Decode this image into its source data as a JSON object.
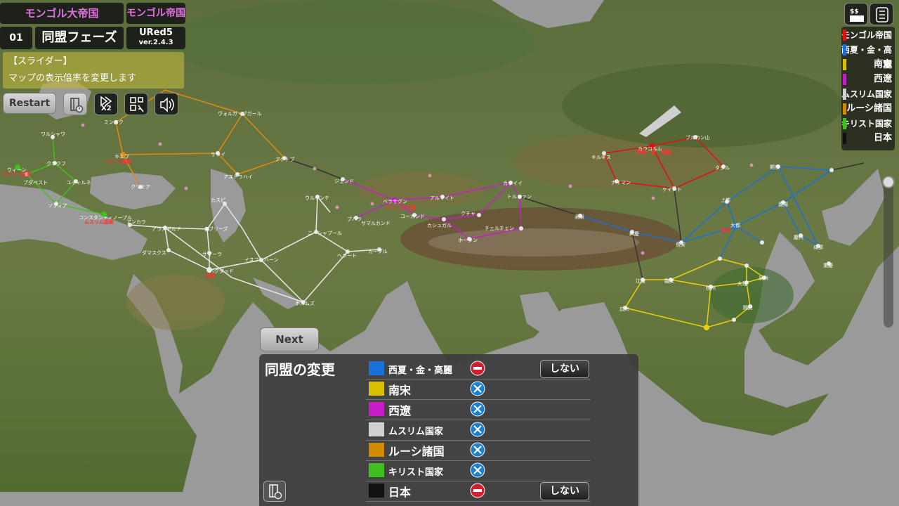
{
  "header": {
    "faction": "モンゴル大帝国",
    "player": "モンゴル帝国",
    "turn": "01",
    "phase": "同盟フェーズ",
    "app_name": "URed5",
    "version": "ver.2.4.3"
  },
  "tooltip": {
    "title": "【スライダー】",
    "text": "マップの表示倍率を変更します"
  },
  "toolbar": {
    "restart_label": "Restart",
    "speed_label": "X2",
    "buttons": [
      "panel-toggle-icon",
      "speed-x2-icon",
      "scan-icon",
      "sound-icon"
    ]
  },
  "legend": {
    "items": [
      {
        "name": "モンゴル帝国",
        "color": "#e01010"
      },
      {
        "name": "西夏・金・高麗",
        "color": "#1a6fd8"
      },
      {
        "name": "南宋",
        "color": "#d8c000"
      },
      {
        "name": "西遼",
        "color": "#c81cc8"
      },
      {
        "name": "ムスリム国家",
        "color": "#d0d0d0"
      },
      {
        "name": "ルーシ諸国",
        "color": "#d08a00"
      },
      {
        "name": "キリスト国家",
        "color": "#40c020"
      },
      {
        "name": "日本",
        "color": "#111111"
      }
    ]
  },
  "next_label": "Next",
  "alliance": {
    "title": "同盟の変更",
    "rows": [
      {
        "name": "西夏・金・高麗",
        "color": "#1a6fd8",
        "status": "blocked",
        "action": "しない"
      },
      {
        "name": "南宋",
        "color": "#d8c000",
        "status": "cross",
        "action": ""
      },
      {
        "name": "西遼",
        "color": "#c81cc8",
        "status": "cross",
        "action": ""
      },
      {
        "name": "ムスリム国家",
        "color": "#d0d0d0",
        "status": "cross",
        "action": ""
      },
      {
        "name": "ルーシ諸国",
        "color": "#d08a00",
        "status": "cross",
        "action": ""
      },
      {
        "name": "キリスト国家",
        "color": "#40c020",
        "status": "cross",
        "action": ""
      },
      {
        "name": "日本",
        "color": "#111111",
        "status": "blocked",
        "action": "しない"
      }
    ]
  },
  "map": {
    "cities_white": [
      "ワルシャワ",
      "クラクフ",
      "ウィーン",
      "ブダペスト",
      "エディルネ",
      "ソフィア",
      "コンスタンティノープル",
      "アンカラ",
      "アラズギルド",
      "タブリーズ",
      "ダマスクス",
      "サマーラ",
      "バグダッド",
      "イスファハーン",
      "ホルムズ",
      "ヘラート",
      "カーブル",
      "ニーシャプール",
      "ウルゲンチ",
      "カスピ",
      "ミンスク",
      "キエフ",
      "クリミア",
      "サライ",
      "アストラハイ",
      "アクトブ",
      "ヴォルガ・ブガール",
      "ジェンド",
      "ベラサグン",
      "アルマイト",
      "カライイ",
      "トルファン",
      "ブハラ",
      "サマルカンド",
      "コーカンド",
      "カシュガル",
      "クチャ",
      "チェルチェン",
      "ホータン",
      "キルギス",
      "カラコルム",
      "ブルカン山",
      "ナイマン",
      "ケイレト",
      "タタル",
      "酒泉",
      "興慶",
      "長安",
      "上都",
      "大都",
      "遼陽",
      "開京",
      "慶州",
      "成都",
      "重慶",
      "江陵",
      "臨安",
      "杭州",
      "大理",
      "泉州",
      "広州",
      "開封"
    ],
    "capitals_red": [
      "ルーシ諸国",
      "キリスト国家",
      "ムスリム国家",
      "西遼",
      "モンゴル帝国",
      "西夏・金・高麗",
      "南宋"
    ]
  }
}
